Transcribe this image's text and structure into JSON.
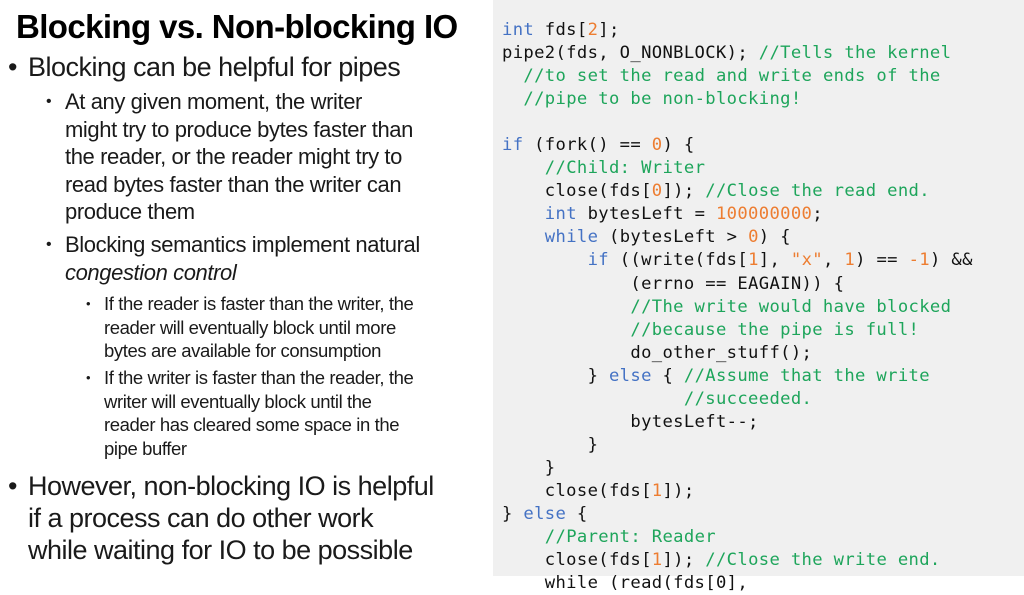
{
  "slide": {
    "title": "Blocking vs. Non-blocking IO",
    "bullets": {
      "b1": "Blocking can be helpful for pipes",
      "b1_1": [
        "At any given moment, the writer",
        "might try to produce bytes faster than",
        "the reader, or the reader might try to",
        "read bytes faster than the writer can",
        "produce them"
      ],
      "b1_2_line1": "Blocking semantics implement natural",
      "b1_2_line2": "congestion control",
      "b1_2_1": [
        "If the reader is faster than the writer, the",
        "reader will eventually block until more",
        "bytes are available for consumption"
      ],
      "b1_2_2": [
        "If the writer is faster than the reader, the",
        "writer will eventually block until the",
        "reader has cleared some space in the",
        "pipe buffer"
      ],
      "b2": [
        "However, non-blocking IO is helpful",
        "if a process can do other work",
        "while waiting for IO to be possible"
      ]
    }
  },
  "colors": {
    "keyword": "#4472c4",
    "number": "#ed7d31",
    "comment": "#1ea55b",
    "code_background": "#f0f0f0"
  },
  "code": {
    "language": "c",
    "lines": [
      [
        [
          "kw",
          "int"
        ],
        [
          "t",
          " fds["
        ],
        [
          "num",
          "2"
        ],
        [
          "t",
          "];"
        ]
      ],
      [
        [
          "t",
          "pipe2(fds, O_NONBLOCK); "
        ],
        [
          "cm",
          "//Tells the kernel"
        ]
      ],
      [
        [
          "t",
          "  "
        ],
        [
          "cm",
          "//to set the read and write ends of the"
        ]
      ],
      [
        [
          "t",
          "  "
        ],
        [
          "cm",
          "//pipe to be non-blocking!"
        ]
      ],
      [
        [
          "t",
          ""
        ]
      ],
      [
        [
          "kw",
          "if"
        ],
        [
          "t",
          " (fork() == "
        ],
        [
          "num",
          "0"
        ],
        [
          "t",
          ") {"
        ]
      ],
      [
        [
          "t",
          "    "
        ],
        [
          "cm",
          "//Child: Writer"
        ]
      ],
      [
        [
          "t",
          "    close(fds["
        ],
        [
          "num",
          "0"
        ],
        [
          "t",
          "]); "
        ],
        [
          "cm",
          "//Close the read end."
        ]
      ],
      [
        [
          "t",
          "    "
        ],
        [
          "kw",
          "int"
        ],
        [
          "t",
          " bytesLeft = "
        ],
        [
          "num",
          "100000000"
        ],
        [
          "t",
          ";"
        ]
      ],
      [
        [
          "t",
          "    "
        ],
        [
          "kw",
          "while"
        ],
        [
          "t",
          " (bytesLeft > "
        ],
        [
          "num",
          "0"
        ],
        [
          "t",
          ") {"
        ]
      ],
      [
        [
          "t",
          "        "
        ],
        [
          "kw",
          "if"
        ],
        [
          "t",
          " ((write(fds["
        ],
        [
          "num",
          "1"
        ],
        [
          "t",
          "], "
        ],
        [
          "str",
          "\"x\""
        ],
        [
          "t",
          ", "
        ],
        [
          "num",
          "1"
        ],
        [
          "t",
          ") == "
        ],
        [
          "num",
          "-1"
        ],
        [
          "t",
          ") &&"
        ]
      ],
      [
        [
          "t",
          "            (errno == EAGAIN)) {"
        ]
      ],
      [
        [
          "t",
          "            "
        ],
        [
          "cm",
          "//The write would have blocked"
        ]
      ],
      [
        [
          "t",
          "            "
        ],
        [
          "cm",
          "//because the pipe is full!"
        ]
      ],
      [
        [
          "t",
          "            do_other_stuff();"
        ]
      ],
      [
        [
          "t",
          "        } "
        ],
        [
          "kw",
          "else"
        ],
        [
          "t",
          " { "
        ],
        [
          "cm",
          "//Assume that the write"
        ]
      ],
      [
        [
          "t",
          "                 "
        ],
        [
          "cm",
          "//succeeded."
        ]
      ],
      [
        [
          "t",
          "            bytesLeft--;"
        ]
      ],
      [
        [
          "t",
          "        }"
        ]
      ],
      [
        [
          "t",
          "    }"
        ]
      ],
      [
        [
          "t",
          "    close(fds["
        ],
        [
          "num",
          "1"
        ],
        [
          "t",
          "]);"
        ]
      ],
      [
        [
          "t",
          "} "
        ],
        [
          "kw",
          "else"
        ],
        [
          "t",
          " {"
        ]
      ],
      [
        [
          "t",
          "    "
        ],
        [
          "cm",
          "//Parent: Reader"
        ]
      ],
      [
        [
          "t",
          "    close(fds["
        ],
        [
          "num",
          "1"
        ],
        [
          "t",
          "]); "
        ],
        [
          "cm",
          "//Close the write end."
        ]
      ],
      [
        [
          "t",
          "    while (read(fds[0],"
        ]
      ]
    ]
  }
}
